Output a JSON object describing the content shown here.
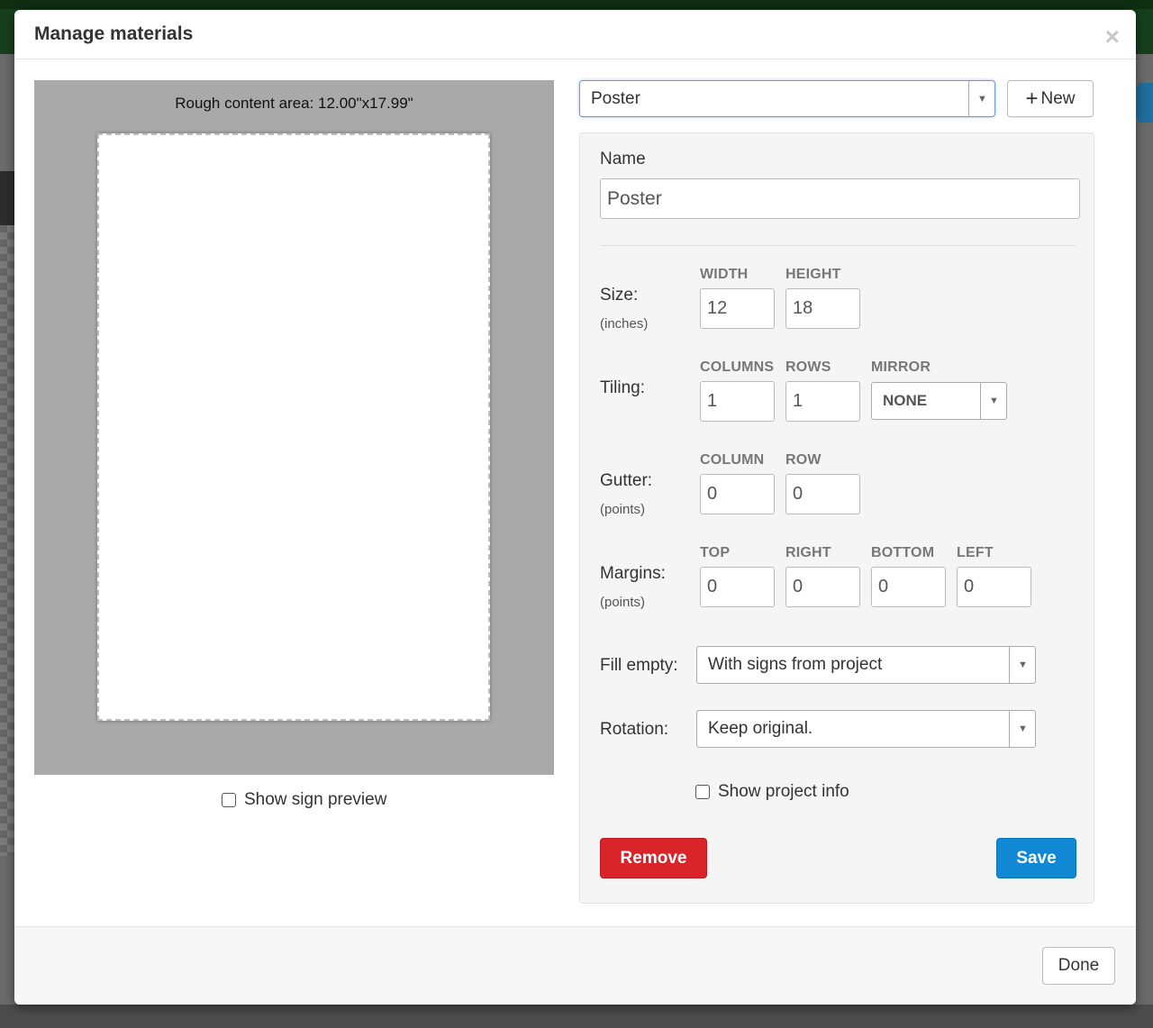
{
  "modal": {
    "title": "Manage materials",
    "close_glyph": "×"
  },
  "preview": {
    "caption": "Rough content area: 12.00\"x17.99\"",
    "show_sign_preview_label": "Show sign preview",
    "show_sign_preview_checked": false
  },
  "material_select": {
    "value": "Poster",
    "arrow": "▼"
  },
  "new_button": {
    "icon": "plus-icon",
    "plus": "+",
    "label": "New"
  },
  "form": {
    "name_label": "Name",
    "name_value": "Poster",
    "size": {
      "label": "Size:",
      "unit": "(inches)",
      "width_head": "WIDTH",
      "height_head": "HEIGHT",
      "width": "12",
      "height": "18"
    },
    "tiling": {
      "label": "Tiling:",
      "columns_head": "COLUMNS",
      "rows_head": "ROWS",
      "mirror_head": "MIRROR",
      "columns": "1",
      "rows": "1",
      "mirror": "NONE"
    },
    "gutter": {
      "label": "Gutter:",
      "unit": "(points)",
      "column_head": "COLUMN",
      "row_head": "ROW",
      "column": "0",
      "row": "0"
    },
    "margins": {
      "label": "Margins:",
      "unit": "(points)",
      "top_head": "TOP",
      "right_head": "RIGHT",
      "bottom_head": "BOTTOM",
      "left_head": "LEFT",
      "top": "0",
      "right": "0",
      "bottom": "0",
      "left": "0"
    },
    "fill_empty": {
      "label": "Fill empty:",
      "value": "With signs from project"
    },
    "rotation": {
      "label": "Rotation:",
      "value": "Keep original."
    },
    "show_project_info_label": "Show project info",
    "show_project_info_checked": false,
    "remove_label": "Remove",
    "save_label": "Save"
  },
  "footer": {
    "done_label": "Done"
  },
  "colors": {
    "remove": "#d9242a",
    "save": "#1188d3",
    "preview_bg": "#a9a9a9",
    "focus_border": "#6e9bd8"
  }
}
